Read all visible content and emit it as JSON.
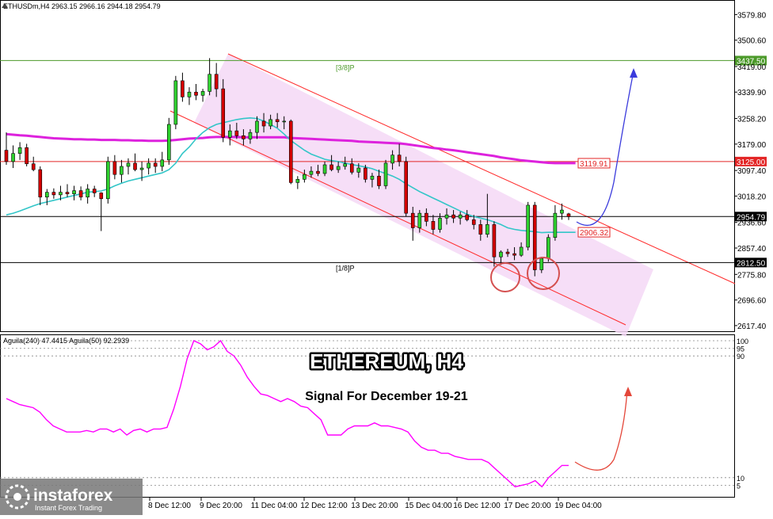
{
  "header": {
    "symbol_info": "ETHUSDm,H4  2963.15 2966.16 2944.18 2954.79"
  },
  "indicator_header": "Aguila(240) 47.4415   Aguila(50) 92.2939",
  "overlay": {
    "title": "ETHEREUM, H4",
    "subtitle": "Signal For December 19-21"
  },
  "branding": {
    "logo_text": "instaforex",
    "tagline": "Instant Forex Trading"
  },
  "chart_data": [
    {
      "type": "candlestick",
      "symbol": "ETHUSDm",
      "timeframe": "H4",
      "ylim": [
        2600,
        3620
      ],
      "y_ticks": [
        3579.8,
        3500.6,
        3419.0,
        3339.9,
        3258.2,
        3179.0,
        3097.4,
        3018.2,
        2936.6,
        2857.4,
        2775.8,
        2696.6,
        2617.4
      ],
      "x_ticks": [
        "8 Dec 12:00",
        "9 Dec 20:00",
        "11 Dec 04:00",
        "12 Dec 12:00",
        "13 Dec 20:00",
        "15 Dec 04:00",
        "16 Dec 12:00",
        "17 Dec 20:00",
        "19 Dec 04:00"
      ],
      "levels": [
        {
          "label": "[3/8]P",
          "price": 3437.5,
          "price_label": "3437.50",
          "color": "#4c9a2a"
        },
        {
          "label": "[1/8]P",
          "price": 2812.5,
          "price_label": "2812.50",
          "color": "#000000"
        },
        {
          "label": "",
          "price": 3125.0,
          "price_label": "3125.00",
          "color": "#e32626"
        },
        {
          "label": "",
          "price": 2954.79,
          "price_label": "2954.79",
          "color": "#000000"
        }
      ],
      "annotations": [
        {
          "text": "3119.91",
          "price": 3119.91
        },
        {
          "text": "2906.32",
          "price": 2906.32
        }
      ],
      "candles": [
        [
          3160,
          3215,
          3115,
          3125
        ],
        [
          3125,
          3175,
          3105,
          3150
        ],
        [
          3150,
          3185,
          3130,
          3168
        ],
        [
          3168,
          3180,
          3110,
          3118
        ],
        [
          3118,
          3140,
          3095,
          3100
        ],
        [
          3100,
          3110,
          2990,
          3015
        ],
        [
          3015,
          3040,
          2990,
          3030
        ],
        [
          3030,
          3042,
          3010,
          3022
        ],
        [
          3022,
          3050,
          3005,
          3030
        ],
        [
          3030,
          3055,
          3015,
          3025
        ],
        [
          3025,
          3050,
          3005,
          3035
        ],
        [
          3035,
          3048,
          3005,
          3015
        ],
        [
          3015,
          3055,
          2995,
          3040
        ],
        [
          3040,
          3050,
          3015,
          3028
        ],
        [
          3028,
          3030,
          2910,
          3010
        ],
        [
          3010,
          3140,
          2995,
          3125
        ],
        [
          3125,
          3145,
          3070,
          3085
        ],
        [
          3085,
          3130,
          3060,
          3110
        ],
        [
          3110,
          3135,
          3085,
          3120
        ],
        [
          3120,
          3150,
          3095,
          3100
        ],
        [
          3100,
          3125,
          3065,
          3105
        ],
        [
          3105,
          3135,
          3085,
          3120
        ],
        [
          3120,
          3135,
          3090,
          3110
        ],
        [
          3110,
          3155,
          3095,
          3130
        ],
        [
          3130,
          3260,
          3115,
          3240
        ],
        [
          3240,
          3390,
          3225,
          3375
        ],
        [
          3375,
          3400,
          3310,
          3325
        ],
        [
          3325,
          3355,
          3300,
          3340
        ],
        [
          3340,
          3365,
          3315,
          3330
        ],
        [
          3330,
          3350,
          3310,
          3342
        ],
        [
          3342,
          3445,
          3330,
          3395
        ],
        [
          3395,
          3430,
          3325,
          3350
        ],
        [
          3350,
          3380,
          3185,
          3200
        ],
        [
          3200,
          3240,
          3175,
          3220
        ],
        [
          3220,
          3245,
          3195,
          3205
        ],
        [
          3205,
          3225,
          3175,
          3195
        ],
        [
          3195,
          3225,
          3180,
          3215
        ],
        [
          3215,
          3265,
          3195,
          3250
        ],
        [
          3250,
          3275,
          3215,
          3235
        ],
        [
          3235,
          3270,
          3225,
          3255
        ],
        [
          3255,
          3275,
          3230,
          3248
        ],
        [
          3248,
          3265,
          3225,
          3250
        ],
        [
          3250,
          3255,
          3055,
          3060
        ],
        [
          3060,
          3080,
          3040,
          3070
        ],
        [
          3070,
          3100,
          3060,
          3085
        ],
        [
          3085,
          3110,
          3075,
          3095
        ],
        [
          3095,
          3115,
          3080,
          3088
        ],
        [
          3088,
          3125,
          3080,
          3115
        ],
        [
          3115,
          3145,
          3095,
          3100
        ],
        [
          3100,
          3125,
          3090,
          3110
        ],
        [
          3110,
          3140,
          3100,
          3118
        ],
        [
          3118,
          3135,
          3085,
          3092
        ],
        [
          3092,
          3120,
          3075,
          3105
        ],
        [
          3105,
          3115,
          3060,
          3070
        ],
        [
          3070,
          3090,
          3045,
          3080
        ],
        [
          3080,
          3100,
          3040,
          3050
        ],
        [
          3050,
          3130,
          3040,
          3120
        ],
        [
          3120,
          3160,
          3100,
          3145
        ],
        [
          3145,
          3180,
          3110,
          3125
        ],
        [
          3125,
          3140,
          2955,
          2965
        ],
        [
          2965,
          2985,
          2880,
          2920
        ],
        [
          2920,
          2975,
          2905,
          2965
        ],
        [
          2965,
          2980,
          2925,
          2940
        ],
        [
          2940,
          2960,
          2900,
          2915
        ],
        [
          2915,
          2965,
          2905,
          2950
        ],
        [
          2950,
          2980,
          2930,
          2960
        ],
        [
          2960,
          2975,
          2935,
          2950
        ],
        [
          2950,
          2970,
          2930,
          2960
        ],
        [
          2960,
          2975,
          2940,
          2945
        ],
        [
          2945,
          2960,
          2915,
          2930
        ],
        [
          2930,
          2945,
          2880,
          2900
        ],
        [
          2900,
          3025,
          2890,
          2930
        ],
        [
          2930,
          2940,
          2800,
          2830
        ],
        [
          2830,
          2850,
          2805,
          2845
        ],
        [
          2845,
          2855,
          2830,
          2840
        ],
        [
          2840,
          2860,
          2820,
          2835
        ],
        [
          2835,
          2875,
          2830,
          2860
        ],
        [
          2860,
          3000,
          2850,
          2990
        ],
        [
          2990,
          3000,
          2770,
          2790
        ],
        [
          2790,
          2830,
          2780,
          2825
        ],
        [
          2825,
          2900,
          2815,
          2890
        ],
        [
          2890,
          2990,
          2880,
          2965
        ],
        [
          2965,
          2995,
          2945,
          2975
        ],
        [
          2963.15,
          2966.16,
          2944.18,
          2954.79
        ]
      ],
      "ma_slow": [
        3210,
        3208,
        3206,
        3205,
        3203,
        3201,
        3199,
        3197,
        3196,
        3195,
        3194,
        3194,
        3193,
        3193,
        3192,
        3192,
        3192,
        3191,
        3191,
        3190,
        3190,
        3189,
        3189,
        3189,
        3190,
        3192,
        3194,
        3196,
        3197,
        3198,
        3200,
        3201,
        3201,
        3201,
        3201,
        3200,
        3200,
        3200,
        3200,
        3200,
        3200,
        3200,
        3198,
        3197,
        3196,
        3195,
        3194,
        3193,
        3192,
        3191,
        3190,
        3189,
        3187,
        3186,
        3185,
        3184,
        3183,
        3182,
        3181,
        3179,
        3176,
        3173,
        3170,
        3167,
        3165,
        3162,
        3160,
        3157,
        3154,
        3151,
        3148,
        3145,
        3142,
        3138,
        3135,
        3132,
        3129,
        3127,
        3125,
        3123,
        3121,
        3120,
        3120,
        3120,
        3120
      ],
      "ma_fast": [
        2960,
        2965,
        2972,
        2980,
        2988,
        2995,
        3000,
        3005,
        3010,
        3015,
        3020,
        3025,
        3030,
        3032,
        3034,
        3040,
        3050,
        3058,
        3065,
        3070,
        3075,
        3080,
        3085,
        3090,
        3100,
        3120,
        3150,
        3170,
        3195,
        3215,
        3230,
        3240,
        3245,
        3250,
        3255,
        3258,
        3260,
        3258,
        3250,
        3240,
        3228,
        3210,
        3190,
        3175,
        3160,
        3148,
        3140,
        3132,
        3128,
        3125,
        3120,
        3116,
        3112,
        3108,
        3103,
        3095,
        3088,
        3080,
        3070,
        3056,
        3044,
        3032,
        3022,
        3012,
        3002,
        2992,
        2982,
        2972,
        2962,
        2955,
        2950,
        2945,
        2938,
        2930,
        2920,
        2915,
        2912,
        2910,
        2908,
        2905,
        2906,
        2906,
        2906,
        2906,
        2906
      ]
    },
    {
      "type": "line",
      "series": [
        {
          "name": "Aguila(240)",
          "color": "#ff00ff"
        }
      ],
      "indicator_values": "Aguila(240) 47.4415  Aguila(50) 92.2939",
      "ylim": [
        0,
        100
      ],
      "levels": [
        100,
        95,
        90,
        10,
        5
      ],
      "values": [
        62,
        60,
        58,
        57,
        56,
        53,
        48,
        44,
        42,
        40,
        40,
        40,
        41,
        40,
        42,
        42,
        40,
        42,
        38,
        41,
        42,
        40,
        42,
        42,
        43,
        55,
        70,
        88,
        100,
        98,
        94,
        96,
        100,
        93,
        90,
        84,
        76,
        70,
        65,
        64,
        62,
        60,
        62,
        60,
        57,
        56,
        52,
        48,
        38,
        38,
        38,
        42,
        44,
        44,
        44,
        46,
        44,
        44,
        43,
        42,
        40,
        34,
        30,
        28,
        28,
        26,
        26,
        24,
        23,
        22,
        22,
        22,
        20,
        16,
        12,
        8,
        4,
        5,
        6,
        8,
        4,
        10,
        14,
        18,
        18
      ]
    }
  ]
}
